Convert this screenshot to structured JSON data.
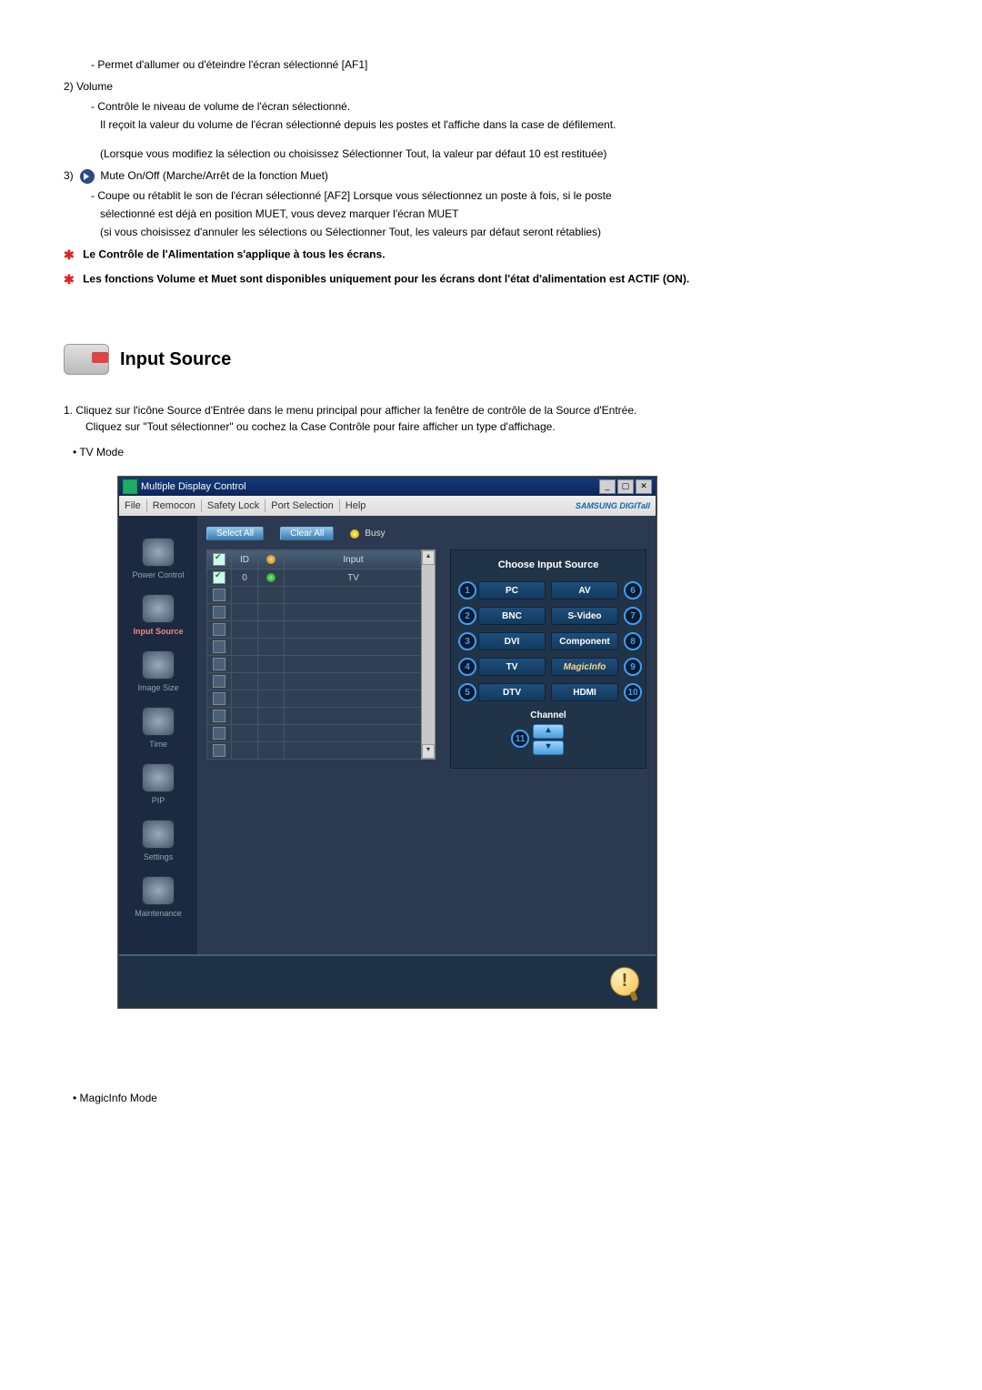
{
  "intro": {
    "item1_line": "- Permet d'allumer ou d'éteindre l'écran sélectionné [AF1]",
    "item2_num": "2)  Volume",
    "item2_l1": "- Contrôle le niveau de volume de l'écran sélectionné.",
    "item2_l2": "Il reçoit la valeur du volume de l'écran sélectionné depuis les postes et l'affiche dans la case de défilement.",
    "item2_l3": "(Lorsque vous modifiez la sélection ou choisissez Sélectionner Tout, la valeur par défaut 10 est restituée)",
    "item3_num": "3)",
    "item3_title": " Mute On/Off (Marche/Arrêt de la fonction Muet)",
    "item3_l1": "- Coupe ou rétablit le son de l'écran sélectionné [AF2] Lorsque vous sélectionnez un poste à fois, si le poste",
    "item3_l2": "sélectionné est déjà en position MUET, vous devez marquer l'écran MUET",
    "item3_l3": "(si vous choisissez d'annuler les sélections ou Sélectionner Tout, les valeurs par défaut seront rétablies)",
    "note1": "Le Contrôle de l'Alimentation s'applique à tous les écrans.",
    "note2": "Les fonctions Volume et Muet sont disponibles uniquement pour les écrans dont l'état d'alimentation est ACTIF (ON)."
  },
  "section": {
    "title": "Input Source",
    "step1a": "1.  Cliquez sur l'icône Source d'Entrée dans le menu principal pour afficher la fenêtre de contrôle de la Source d'Entrée.",
    "step1b": "Cliquez sur \"Tout sélectionner\" ou cochez la Case Contrôle pour faire afficher un type d'affichage.",
    "bullet_tv": "TV Mode",
    "bullet_magic": "MagicInfo Mode"
  },
  "app": {
    "title": "Multiple Display Control",
    "menu": [
      "File",
      "Remocon",
      "Safety Lock",
      "Port Selection",
      "Help"
    ],
    "brand": "SAMSUNG DIGITall",
    "btn_select": "Select All",
    "btn_clear": "Clear All",
    "busy": "Busy",
    "table": {
      "headers": [
        "",
        "ID",
        "",
        "Input"
      ],
      "rows": [
        {
          "checked": true,
          "id": "0",
          "status": "green",
          "input": "TV"
        },
        {
          "checked": false,
          "id": "",
          "status": "",
          "input": ""
        },
        {
          "checked": false,
          "id": "",
          "status": "",
          "input": ""
        },
        {
          "checked": false,
          "id": "",
          "status": "",
          "input": ""
        },
        {
          "checked": false,
          "id": "",
          "status": "",
          "input": ""
        },
        {
          "checked": false,
          "id": "",
          "status": "",
          "input": ""
        },
        {
          "checked": false,
          "id": "",
          "status": "",
          "input": ""
        },
        {
          "checked": false,
          "id": "",
          "status": "",
          "input": ""
        },
        {
          "checked": false,
          "id": "",
          "status": "",
          "input": ""
        },
        {
          "checked": false,
          "id": "",
          "status": "",
          "input": ""
        },
        {
          "checked": false,
          "id": "",
          "status": "",
          "input": ""
        }
      ]
    },
    "sidebar": [
      {
        "label": "Power Control"
      },
      {
        "label": "Input Source",
        "active": true
      },
      {
        "label": "Image Size"
      },
      {
        "label": "Time"
      },
      {
        "label": "PIP"
      },
      {
        "label": "Settings"
      },
      {
        "label": "Maintenance"
      }
    ],
    "right": {
      "title": "Choose Input Source",
      "left_nums": [
        "1",
        "2",
        "3",
        "4",
        "5"
      ],
      "left_btns": [
        "PC",
        "BNC",
        "DVI",
        "TV",
        "DTV"
      ],
      "right_btns": [
        "AV",
        "S-Video",
        "Component",
        "MagicInfo",
        "HDMI"
      ],
      "right_nums": [
        "6",
        "7",
        "8",
        "9",
        "10"
      ],
      "channel_label": "Channel",
      "channel_num": "11",
      "up": "▴",
      "down": "▾"
    }
  }
}
